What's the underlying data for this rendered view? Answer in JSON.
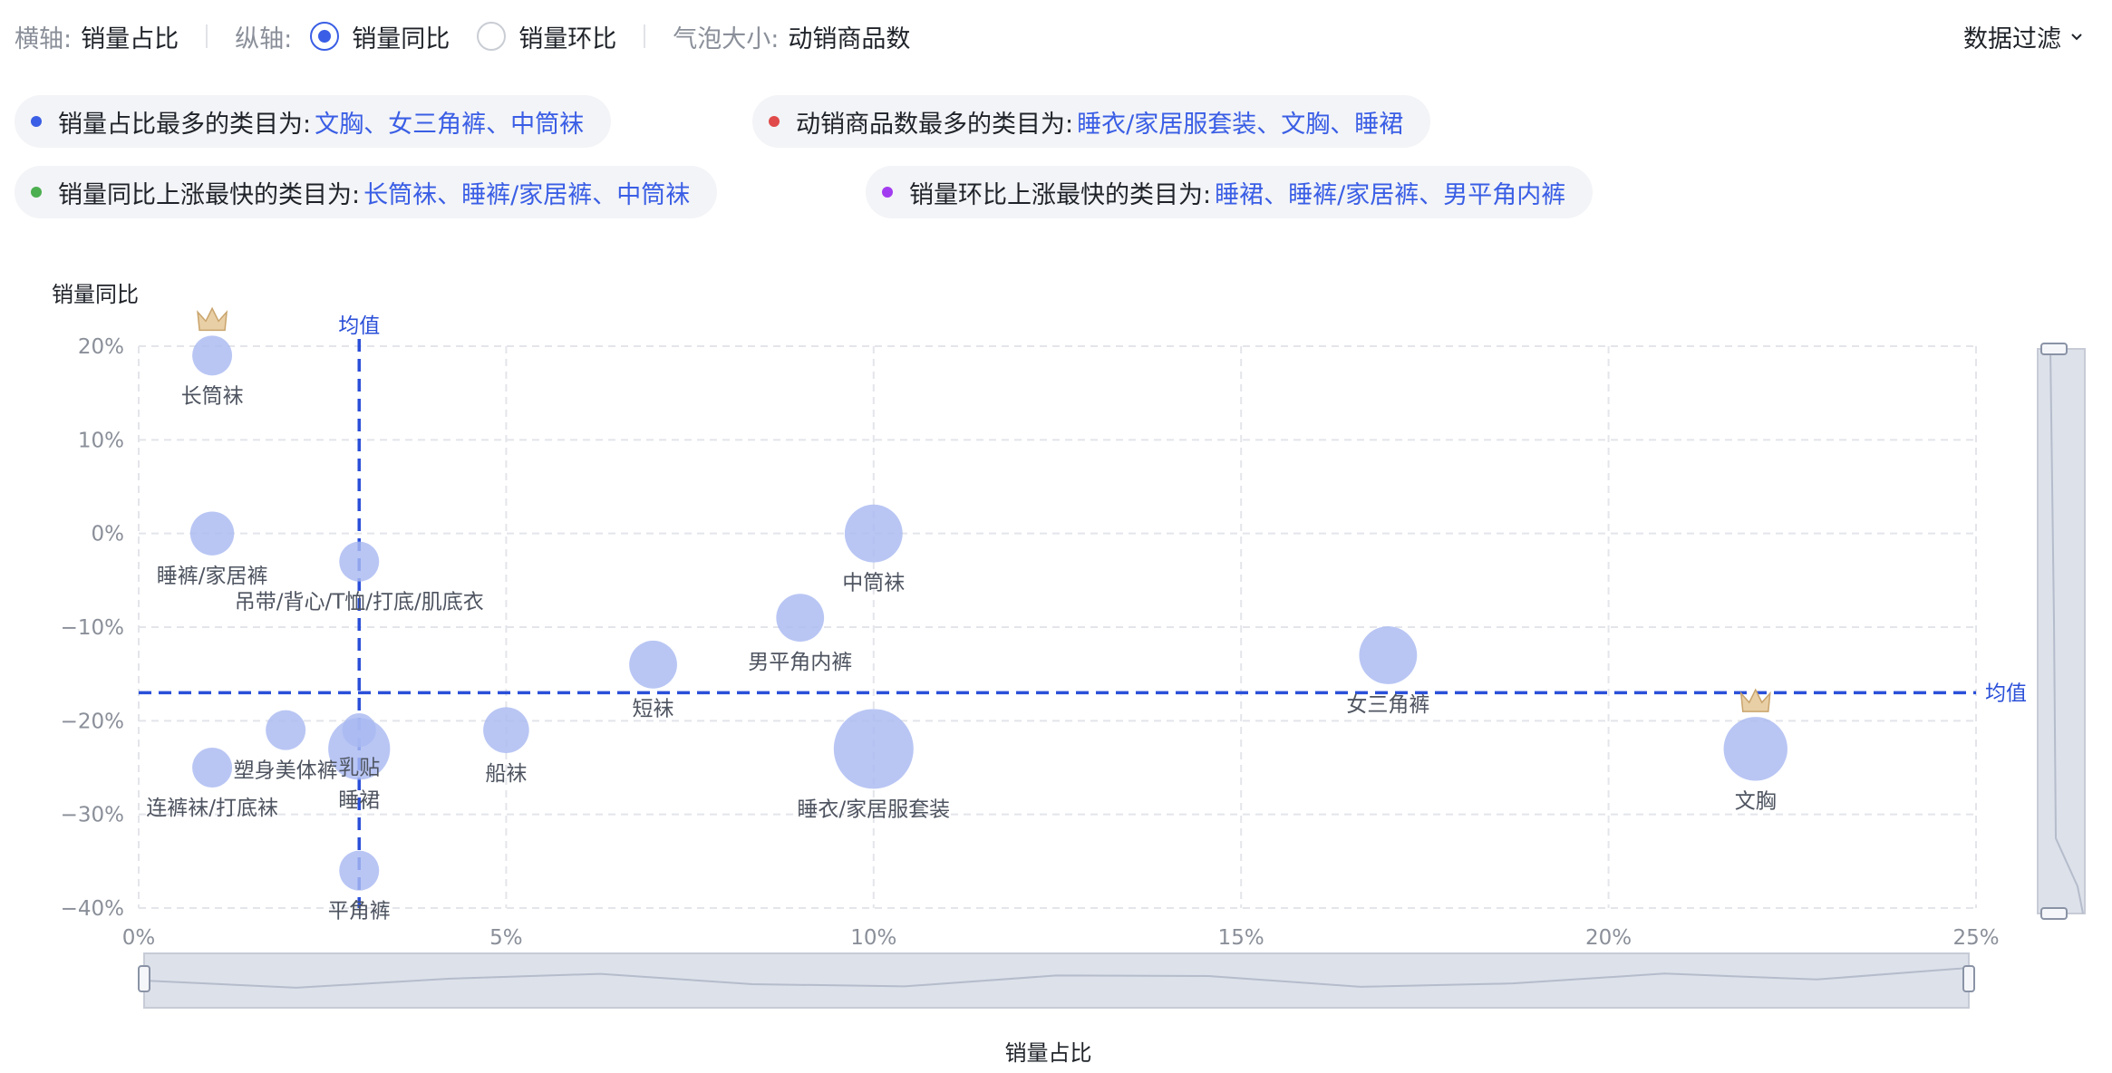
{
  "toolbar": {
    "x_axis_label": "横轴:",
    "x_axis_value": "销量占比",
    "y_axis_label": "纵轴:",
    "y_options": [
      {
        "label": "销量同比",
        "checked": true
      },
      {
        "label": "销量环比",
        "checked": false
      }
    ],
    "size_label": "气泡大小:",
    "size_value": "动销商品数",
    "filter_label": "数据过滤"
  },
  "insights": [
    {
      "prefix": "销量占比最多的类目为:",
      "value": "文胸、女三角裤、中筒袜",
      "color": "#3a5ee5"
    },
    {
      "prefix": "动销商品数最多的类目为:",
      "value": "睡衣/家居服套装、文胸、睡裙",
      "color": "#e04a4a"
    },
    {
      "prefix": "销量同比上涨最快的类目为:",
      "value": "长筒袜、睡裤/家居裤、中筒袜",
      "color": "#4caf50"
    },
    {
      "prefix": "销量环比上涨最快的类目为:",
      "value": "睡裙、睡裤/家居裤、男平角内裤",
      "color": "#a23cf0"
    }
  ],
  "chart_data": {
    "type": "scatter",
    "xlabel": "销量占比",
    "ylabel": "销量同比",
    "xlim": [
      0,
      25
    ],
    "ylim": [
      -40,
      20
    ],
    "x_ticks": [
      "0%",
      "5%",
      "10%",
      "15%",
      "20%",
      "25%"
    ],
    "y_ticks": [
      "20%",
      "10%",
      "0%",
      "−10%",
      "−20%",
      "−30%",
      "−40%"
    ],
    "mean_label": "均值",
    "mean_x": 3,
    "mean_y": -17,
    "grid": true,
    "bubble_color": "#a9b9f2",
    "mean_line_color": "#2a4fd8",
    "points": [
      {
        "name": "长筒袜",
        "x": 1,
        "y": 19,
        "size": 1.0,
        "crown": true
      },
      {
        "name": "睡裤/家居裤",
        "x": 1,
        "y": 0,
        "size": 1.1
      },
      {
        "name": "吊带/背心/T恤/打底/肌底衣",
        "x": 3,
        "y": -3,
        "size": 1.0
      },
      {
        "name": "中筒袜",
        "x": 10,
        "y": 0,
        "size": 1.45
      },
      {
        "name": "男平角内裤",
        "x": 9,
        "y": -9,
        "size": 1.2
      },
      {
        "name": "短袜",
        "x": 7,
        "y": -14,
        "size": 1.2
      },
      {
        "name": "女三角裤",
        "x": 17,
        "y": -13,
        "size": 1.45
      },
      {
        "name": "塑身美体裤",
        "x": 2,
        "y": -21,
        "size": 1.0
      },
      {
        "name": "乳贴",
        "x": 3,
        "y": -21,
        "size": 0.85
      },
      {
        "name": "睡裙",
        "x": 3,
        "y": -23,
        "size": 1.55
      },
      {
        "name": "船袜",
        "x": 5,
        "y": -21,
        "size": 1.15
      },
      {
        "name": "连裤袜/打底袜",
        "x": 1,
        "y": -25,
        "size": 1.0
      },
      {
        "name": "睡衣/家居服套装",
        "x": 10,
        "y": -23,
        "size": 2.0
      },
      {
        "name": "文胸",
        "x": 22,
        "y": -23,
        "size": 1.6,
        "crown": true
      },
      {
        "name": "平角裤",
        "x": 3,
        "y": -36,
        "size": 1.0
      }
    ]
  }
}
